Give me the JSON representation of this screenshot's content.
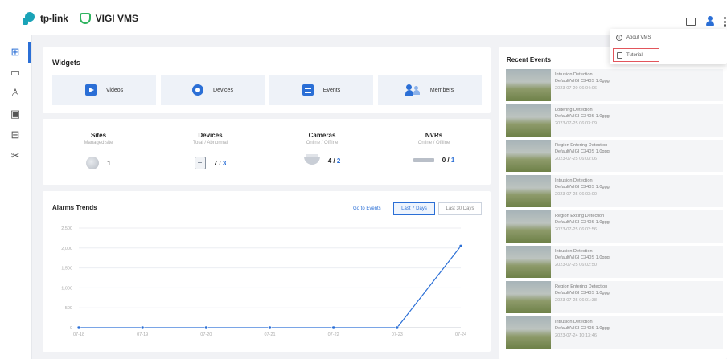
{
  "header": {
    "brand": "tp-link",
    "product": "VIGI VMS"
  },
  "menu": {
    "about": "About VMS",
    "tutorial": "Tutorial"
  },
  "sidebar": {
    "items": [
      {
        "icon": "dashboard-icon",
        "glyph": "⊞"
      },
      {
        "icon": "video-icon",
        "glyph": "▭"
      },
      {
        "icon": "alarm-icon",
        "glyph": "♙"
      },
      {
        "icon": "device-icon",
        "glyph": "▣"
      },
      {
        "icon": "map-icon",
        "glyph": "⊟"
      },
      {
        "icon": "tools-icon",
        "glyph": "✂"
      }
    ]
  },
  "widgets": {
    "title": "Widgets",
    "buttons": [
      {
        "label": "Videos",
        "icon": "play-icon"
      },
      {
        "label": "Devices",
        "icon": "devices-icon"
      },
      {
        "label": "Events",
        "icon": "events-icon"
      },
      {
        "label": "Members",
        "icon": "members-icon"
      }
    ]
  },
  "stats": [
    {
      "name": "Sites",
      "sub": "Managed site",
      "value": "1",
      "secondary": ""
    },
    {
      "name": "Devices",
      "sub": "Total / Abnormal",
      "value": "7",
      "secondary": "3"
    },
    {
      "name": "Cameras",
      "sub": "Online / Offline",
      "value": "4",
      "secondary": "2"
    },
    {
      "name": "NVRs",
      "sub": "Online / Offline",
      "value": "0",
      "secondary": "1"
    }
  ],
  "alarms": {
    "title": "Alarms Trends",
    "goto": "Go to Events",
    "ranges": [
      "Last 7 Days",
      "Last 30 Days"
    ],
    "active_range": 0
  },
  "chart_data": {
    "type": "line",
    "categories": [
      "07-18",
      "07-19",
      "07-20",
      "07-21",
      "07-22",
      "07-23",
      "07-24"
    ],
    "values": [
      0,
      0,
      0,
      0,
      0,
      0,
      2050
    ],
    "ylim": [
      0,
      2500
    ],
    "yticks": [
      0,
      500,
      1000,
      1500,
      2000,
      2500
    ],
    "ytick_labels": [
      "0",
      "500",
      "1,000",
      "1,500",
      "2,000",
      "2,500"
    ],
    "grid": true,
    "color": "#2b6fd6"
  },
  "events": {
    "title": "Recent Events",
    "items": [
      {
        "type": "Intrusion Detection",
        "source": "Default/VIGI C340S 1.0ggg",
        "time": "2023-07-20 06:04:06"
      },
      {
        "type": "Loitering Detection",
        "source": "Default/VIGI C340S 1.0ggg",
        "time": "2023-07-25 06:03:09"
      },
      {
        "type": "Region Entering Detection",
        "source": "Default/VIGI C340S 1.0ggg",
        "time": "2023-07-25 06:03:06"
      },
      {
        "type": "Intrusion Detection",
        "source": "Default/VIGI C340S 1.0ggg",
        "time": "2023-07-25 06:03:00"
      },
      {
        "type": "Region Exiting Detection",
        "source": "Default/VIGI C340S 1.0ggg",
        "time": "2023-07-25 06:02:56"
      },
      {
        "type": "Intrusion Detection",
        "source": "Default/VIGI C340S 1.0ggg",
        "time": "2023-07-25 06:02:50"
      },
      {
        "type": "Region Entering Detection",
        "source": "Default/VIGI C340S 1.0ggg",
        "time": "2023-07-25 06:01:38"
      },
      {
        "type": "Intrusion Detection",
        "source": "Default/VIGI C340S 1.0ggg",
        "time": "2023-07-24 10:13:46"
      }
    ]
  }
}
